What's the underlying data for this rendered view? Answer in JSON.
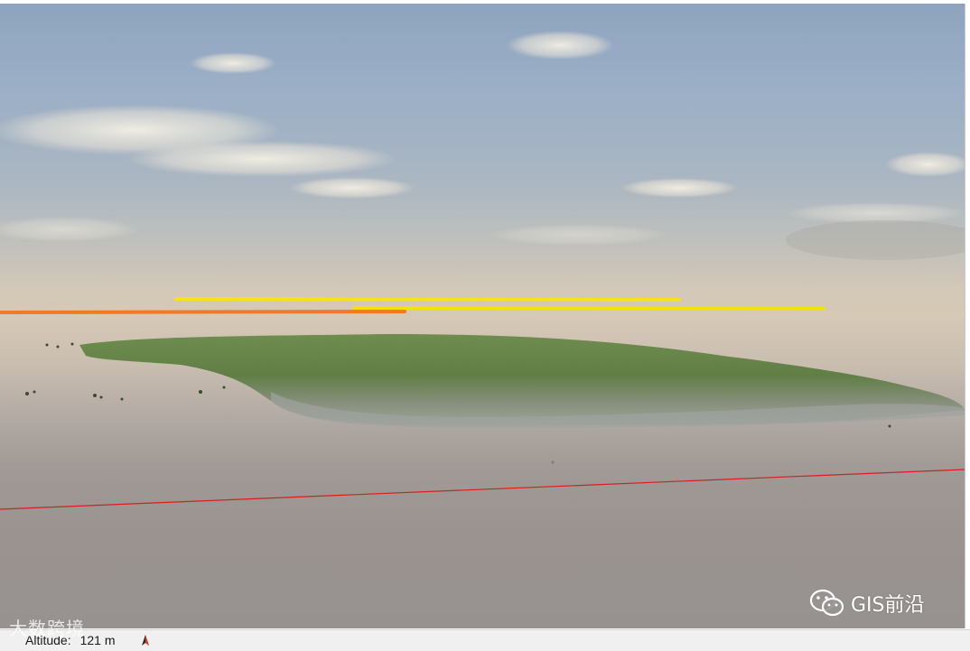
{
  "statusbar": {
    "altitude_label": "Altitude:",
    "altitude_value": "121 m"
  },
  "watermark_left": {
    "text": "大数跨境"
  },
  "watermark_right": {
    "text": "GIS前沿",
    "icon": "wechat-icon"
  },
  "colors": {
    "sky_top": "#8ea3bd",
    "horizon": "#d6c9b6",
    "ground": "#979290",
    "flight_line_yellow": "#f5e21a",
    "flight_line_orange": "#ee7a2a",
    "red_line": "#d42020",
    "vegetation": "#5a7a3a"
  }
}
